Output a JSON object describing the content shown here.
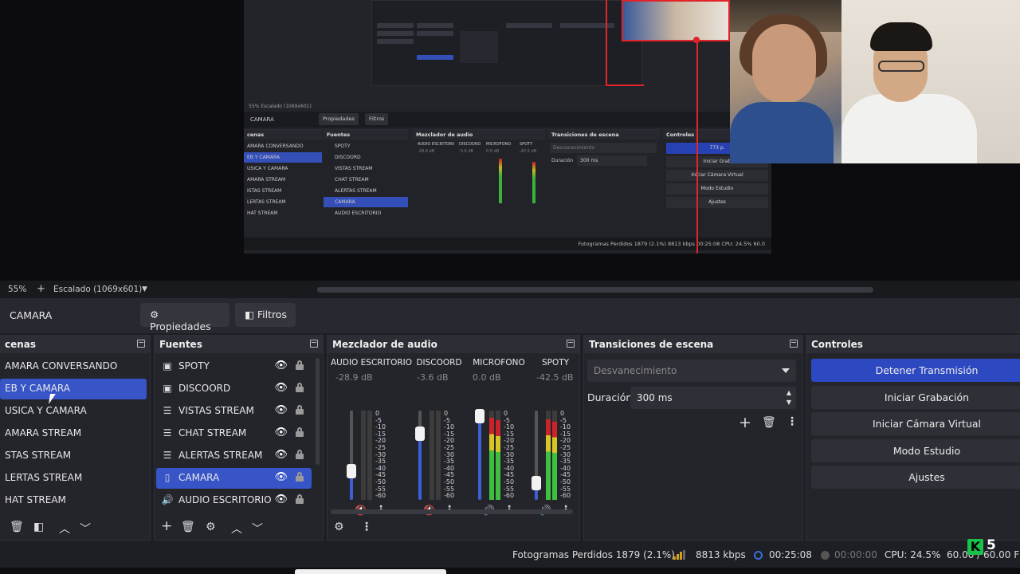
{
  "preview": {
    "program": {
      "zoom_text": "55%  Escalado (1069x601)",
      "scene_title": "CAMARA",
      "buttons": [
        "Propiedades",
        "Filtros"
      ],
      "docks": {
        "scenes": {
          "header": "cenas",
          "items": [
            "AMARA CONVERSANDO",
            "EB Y CAMARA",
            "USICA Y CAMARA",
            "AMARA STREAM",
            "ISTAS STREAM",
            "LERTAS STREAM",
            "HAT STREAM"
          ]
        },
        "sources": {
          "header": "Fuentes",
          "items": [
            "SPOTY",
            "DISCOORD",
            "VISTAS STREAM",
            "CHAT STREAM",
            "ALERTAS STREAM",
            "CAMARA",
            "AUDIO ESCRITORIO"
          ]
        },
        "mixer": {
          "header": "Mezclador de audio",
          "channels": [
            "AUDIO ESCRITORIO",
            "DISCOORD",
            "MICROFONO",
            "SPOTY"
          ],
          "db": [
            "-28.9 dB",
            "-3.6 dB",
            "0.0 dB",
            "-42.5 dB"
          ]
        },
        "transitions": {
          "header": "Transiciones de escena",
          "select": "Desvanecimiento",
          "duration_label": "Duración",
          "duration": "300 ms"
        },
        "controls": {
          "header": "Controles",
          "items": [
            "773 p.",
            "Iniciar Grab",
            "Iniciar Cámara Virtual",
            "Modo Estudio",
            "Ajustes"
          ]
        }
      },
      "status": "Fotogramas Perdidos 1879 (2.1%)   8813 kbps   00:25:08   CPU: 24.5%  60.0"
    },
    "watermark_num": "5"
  },
  "zoombar": {
    "zoom": "55%",
    "plus": "+",
    "scaling": "Escalado (1069x601)",
    "dropdown_arrow": "▼"
  },
  "toolbar": {
    "scene_name": "CAMARA",
    "properties_label": "Propiedades",
    "filters_label": "Filtros"
  },
  "scenes": {
    "header": "cenas",
    "items": [
      {
        "label": "AMARA CONVERSANDO"
      },
      {
        "label": "EB Y CAMARA"
      },
      {
        "label": "USICA Y CAMARA"
      },
      {
        "label": "AMARA STREAM"
      },
      {
        "label": "STAS STREAM"
      },
      {
        "label": "LERTAS STREAM"
      },
      {
        "label": "HAT STREAM"
      }
    ],
    "selected_index": 1
  },
  "sources": {
    "header": "Fuentes",
    "items": [
      {
        "label": "SPOTY",
        "icon": "window-capture-icon"
      },
      {
        "label": "DISCOORD",
        "icon": "window-capture-icon"
      },
      {
        "label": "VISTAS STREAM",
        "icon": "browser-source-icon"
      },
      {
        "label": "CHAT STREAM",
        "icon": "browser-source-icon"
      },
      {
        "label": "ALERTAS STREAM",
        "icon": "browser-source-icon"
      },
      {
        "label": "CAMARA",
        "icon": "video-device-icon"
      },
      {
        "label": "AUDIO ESCRITORIO",
        "icon": "audio-output-icon"
      }
    ],
    "selected_index": 5
  },
  "mixer": {
    "header": "Mezclador de audio",
    "scale": [
      "0",
      "-5",
      "-10",
      "-15",
      "-20",
      "-25",
      "-30",
      "-35",
      "-40",
      "-45",
      "-50",
      "-55",
      "-60"
    ],
    "channels": [
      {
        "name": "AUDIO ESCRITORIO",
        "db": "-28.9 dB",
        "fader_level": 0.38,
        "meter_level": 0.0,
        "muted": true
      },
      {
        "name": "DISCOORD",
        "db": "-3.6 dB",
        "fader_level": 0.8,
        "meter_level": 0.0,
        "muted": true
      },
      {
        "name": "MICROFONO",
        "db": "0.0 dB",
        "fader_level": 1.0,
        "meter_level": 0.92,
        "muted": false
      },
      {
        "name": "SPOTY",
        "db": "-42.5 dB",
        "fader_level": 0.25,
        "meter_level": 0.9,
        "muted": false
      }
    ]
  },
  "transitions": {
    "header": "Transiciones de escena",
    "selected": "Desvanecimiento",
    "duration_label": "Duración",
    "duration_value": "300 ms"
  },
  "controls": {
    "header": "Controles",
    "buttons": [
      {
        "label": "Detener Transmisión",
        "primary": true
      },
      {
        "label": "Iniciar Grabación",
        "primary": false
      },
      {
        "label": "Iniciar Cámara Virtual",
        "primary": false
      },
      {
        "label": "Modo Estudio",
        "primary": false
      },
      {
        "label": "Ajustes",
        "primary": false
      }
    ]
  },
  "status": {
    "dropped_frames": "Fotogramas Perdidos 1879 (2.1%)",
    "bitrate": "8813 kbps",
    "live_time": "00:25:08",
    "rec_time": "00:00:00",
    "cpu": "CPU: 24.5%",
    "fps": "60.00 / 60.00 FPS"
  },
  "watermark": {
    "letter": "K",
    "number": "5"
  },
  "colors": {
    "accent": "#3855c7",
    "primary_button": "#2d49c2",
    "fader": "#3b5fd6",
    "meter_green": "#3fbf3f",
    "meter_yellow": "#d7c425",
    "meter_red": "#c8242a",
    "selection_red": "#e0242a"
  }
}
